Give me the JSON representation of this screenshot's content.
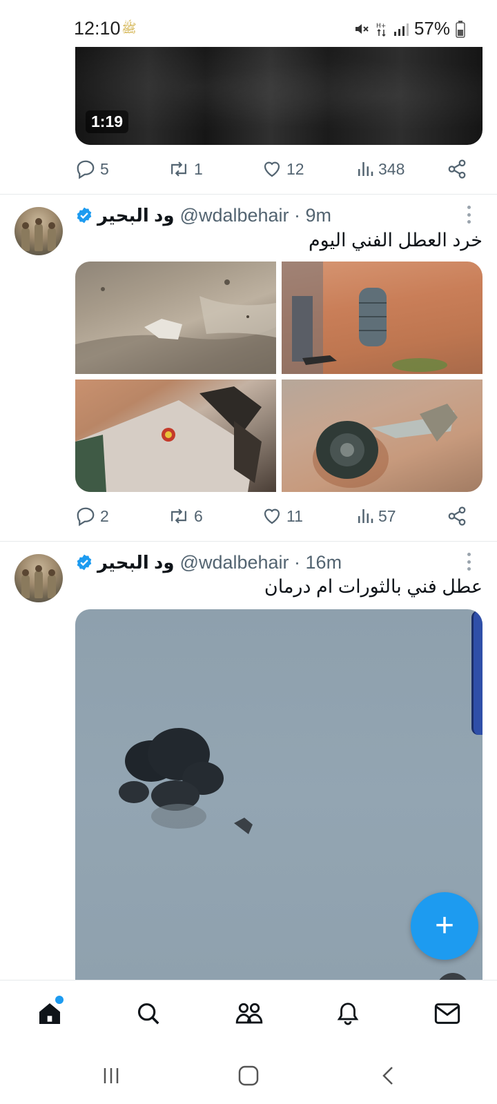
{
  "status_bar": {
    "time": "12:10",
    "extra_icon": "ﷺ",
    "battery": "57%",
    "icons": [
      "mute-icon",
      "data-icon",
      "signal-icon",
      "battery-icon"
    ]
  },
  "tweets": [
    {
      "media": {
        "duration": "1:19"
      },
      "stats": {
        "replies": "5",
        "retweets": "1",
        "likes": "12",
        "views": "348"
      }
    },
    {
      "display_name": "ود البحير",
      "handle_time": "@wdalbehair · 9m",
      "text": "خرد العطل الفني اليوم",
      "stats": {
        "replies": "2",
        "retweets": "6",
        "likes": "11",
        "views": "57"
      }
    },
    {
      "display_name": "ود البحير",
      "handle_time": "@wdalbehair · 16m",
      "text": "عطل فني بالثورات ام درمان"
    }
  ],
  "fab": {
    "label": "+"
  },
  "bottom_nav": [
    "home-icon",
    "search-icon",
    "communities-icon",
    "notifications-icon",
    "messages-icon"
  ],
  "colors": {
    "accent": "#1d9bf0",
    "muted": "#536471",
    "text": "#0f1419"
  }
}
